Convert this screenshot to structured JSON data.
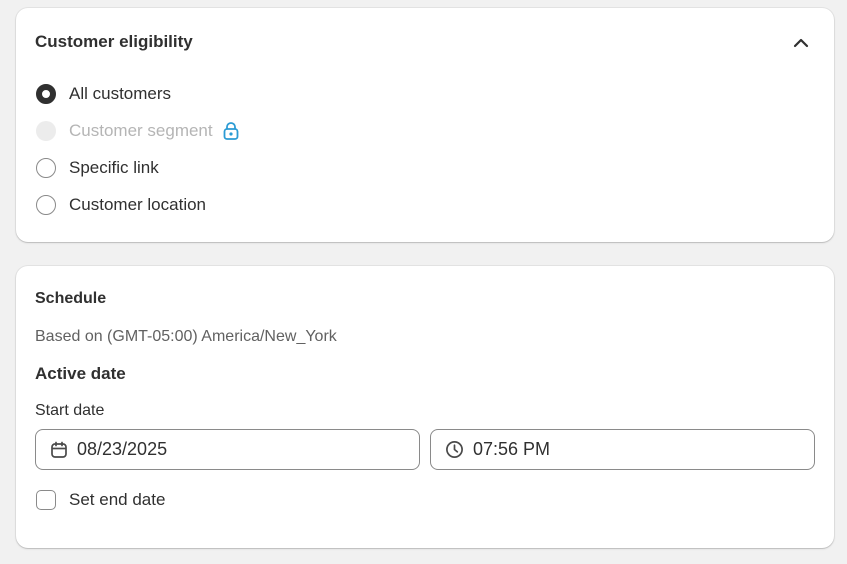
{
  "eligibility": {
    "title": "Customer eligibility",
    "collapse_icon": "chevron-up-icon",
    "options": [
      {
        "label": "All customers",
        "state": "checked"
      },
      {
        "label": "Customer segment",
        "state": "disabled",
        "icon": "lock-icon"
      },
      {
        "label": "Specific link",
        "state": "unchecked"
      },
      {
        "label": "Customer location",
        "state": "unchecked"
      }
    ]
  },
  "schedule": {
    "title": "Schedule",
    "timezone_text": "Based on (GMT-05:00) America/New_York",
    "active_date_title": "Active date",
    "start_date_label": "Start date",
    "start_date_value": "08/23/2025",
    "start_time_value": "07:56 PM",
    "end_date_checkbox_label": "Set end date",
    "end_date_checked": false
  },
  "colors": {
    "background": "#f1f1f1",
    "card": "#ffffff",
    "text": "#303030",
    "muted_text": "#616161",
    "disabled_text": "#b5b5b5",
    "lock_accent": "#2b9bd4"
  }
}
